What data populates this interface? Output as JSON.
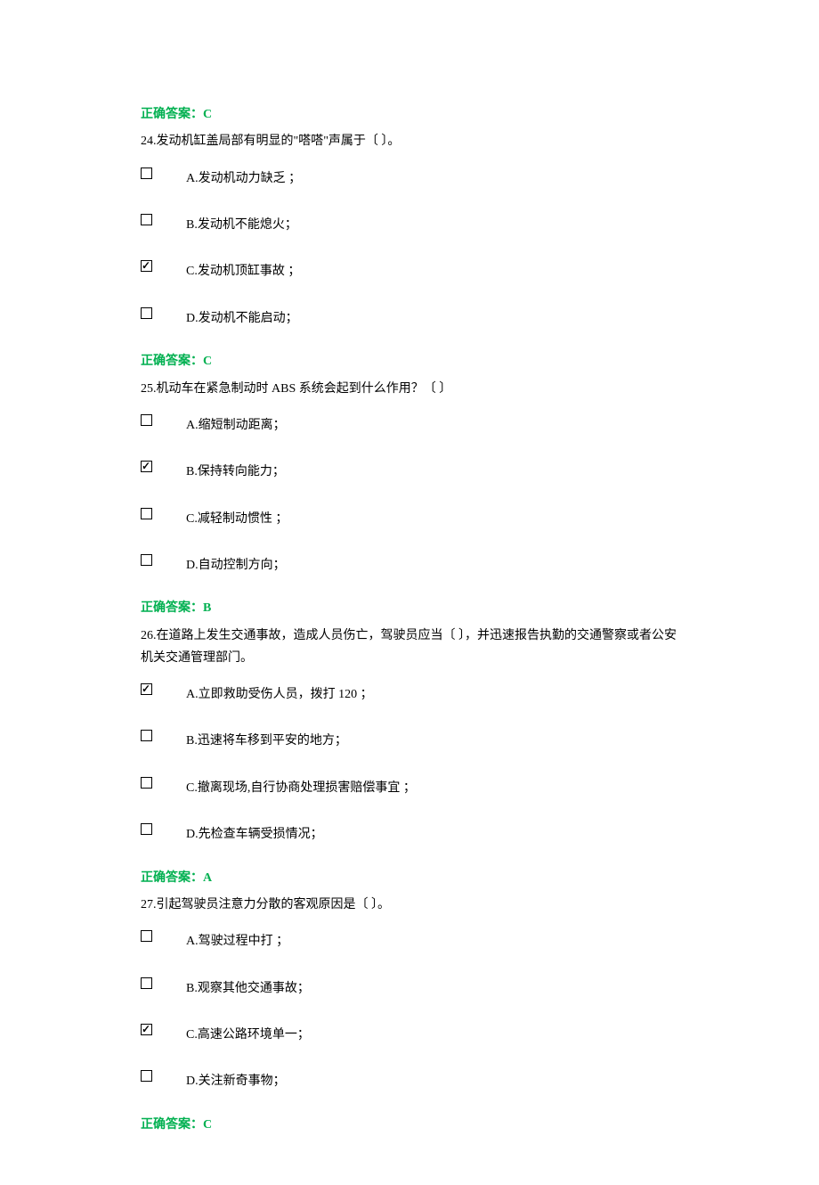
{
  "answer_prefix": "正确答案：",
  "questions": [
    {
      "pre_answer": "C",
      "number": "24",
      "text": "24.发动机缸盖局部有明显的\"嗒嗒\"声属于〔 〕。",
      "options": [
        {
          "label": "A.发动机动力缺乏 ；",
          "checked": false
        },
        {
          "label": "B.发动机不能熄火；",
          "checked": false
        },
        {
          "label": "C.发动机顶缸事故 ；",
          "checked": true
        },
        {
          "label": "D.发动机不能启动；",
          "checked": false
        }
      ],
      "answer": "C"
    },
    {
      "number": "25",
      "text": "25.机动车在紧急制动时 ABS 系统会起到什么作用？〔 〕",
      "options": [
        {
          "label": "A.缩短制动距离；",
          "checked": false
        },
        {
          "label": "B.保持转向能力；",
          "checked": true
        },
        {
          "label": "C.减轻制动惯性 ；",
          "checked": false
        },
        {
          "label": "D.自动控制方向；",
          "checked": false
        }
      ],
      "answer": "B"
    },
    {
      "number": "26",
      "text": "26.在道路上发生交通事故，造成人员伤亡，驾驶员应当〔 〕，并迅速报告执勤的交通警察或者公安机关交通管理部门。",
      "options": [
        {
          "label": "A.立即救助受伤人员，拨打 120 ；",
          "checked": true
        },
        {
          "label": "B.迅速将车移到平安的地方；",
          "checked": false
        },
        {
          "label": "C.撤离现场,自行协商处理损害赔偿事宜 ；",
          "checked": false
        },
        {
          "label": "D.先检查车辆受损情况；",
          "checked": false
        }
      ],
      "answer": "A"
    },
    {
      "number": "27",
      "text": "27.引起驾驶员注意力分散的客观原因是〔 〕。",
      "options": [
        {
          "label": "A.驾驶过程中打    ；",
          "checked": false
        },
        {
          "label": "B.观察其他交通事故；",
          "checked": false
        },
        {
          "label": "C.高速公路环境单一；",
          "checked": true
        },
        {
          "label": "D.关注新奇事物；",
          "checked": false
        }
      ],
      "answer": "C"
    }
  ]
}
